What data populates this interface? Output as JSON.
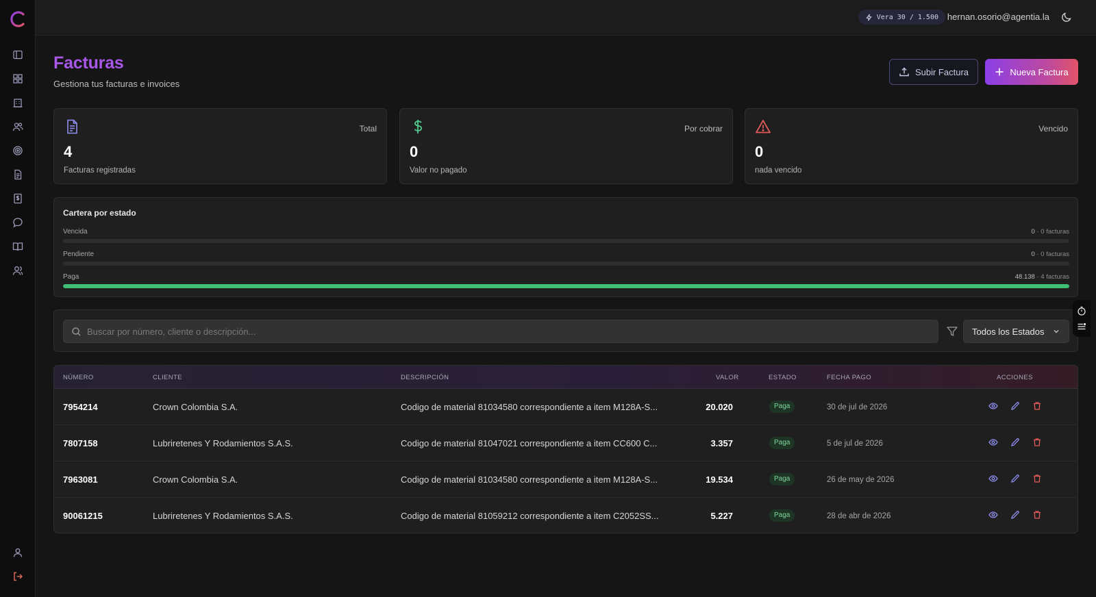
{
  "header": {
    "credits": "Vera 30 / 1.500",
    "user_email": "hernan.osorio@agentia.la"
  },
  "page": {
    "title": "Facturas",
    "subtitle": "Gestiona tus facturas e invoices",
    "upload_label": "Subir Factura",
    "new_label": "Nueva Factura"
  },
  "stats": [
    {
      "label": "Total",
      "value": "4",
      "caption": "Facturas registradas",
      "icon": "document-icon",
      "color": "#8f8ff0"
    },
    {
      "label": "Por cobrar",
      "value": "0",
      "caption": "Valor no pagado",
      "icon": "dollar-icon",
      "color": "#4fc98a"
    },
    {
      "label": "Vencido",
      "value": "0",
      "caption": "nada vencido",
      "icon": "warning-icon",
      "color": "#e25a5a"
    }
  ],
  "cartera": {
    "title": "Cartera por estado",
    "rows": [
      {
        "label": "Vencida",
        "amount": "0",
        "count": "· 0 facturas",
        "fraction": 0,
        "color": "#e25a5a"
      },
      {
        "label": "Pendiente",
        "amount": "0",
        "count": "· 0 facturas",
        "fraction": 0,
        "color": "#d6a84a"
      },
      {
        "label": "Paga",
        "amount": "48.138",
        "count": "· 4 facturas",
        "fraction": 1,
        "color": "#3fbf74"
      }
    ]
  },
  "filter": {
    "search_placeholder": "Buscar por número, cliente o descripción...",
    "status_select": "Todos los Estados"
  },
  "table": {
    "headers": {
      "numero": "NÚMERO",
      "cliente": "CLIENTE",
      "descripcion": "DESCRIPCIÓN",
      "valor": "VALOR",
      "estado": "ESTADO",
      "fecha": "FECHA PAGO",
      "acciones": "ACCIONES"
    },
    "rows": [
      {
        "numero": "7954214",
        "cliente": "Crown Colombia S.A.",
        "descripcion": "Codigo de material 81034580 correspondiente a item M128A-S...",
        "valor": "20.020",
        "estado": "Paga",
        "fecha": "30 de jul de 2026"
      },
      {
        "numero": "7807158",
        "cliente": "Lubriretenes Y Rodamientos S.A.S.",
        "descripcion": "Codigo de material 81047021 correspondiente a item CC600 C...",
        "valor": "3.357",
        "estado": "Paga",
        "fecha": "5 de jul de 2026"
      },
      {
        "numero": "7963081",
        "cliente": "Crown Colombia S.A.",
        "descripcion": "Codigo de material 81034580 correspondiente a item M128A-S...",
        "valor": "19.534",
        "estado": "Paga",
        "fecha": "26 de may de 2026"
      },
      {
        "numero": "90061215",
        "cliente": "Lubriretenes Y Rodamientos S.A.S.",
        "descripcion": "Codigo de material 81059212 correspondiente a item C2052SS...",
        "valor": "5.227",
        "estado": "Paga",
        "fecha": "28 de abr de 2026"
      }
    ]
  },
  "colors": {
    "accent": "#a857e8",
    "paid": "#7fd79c",
    "danger": "#e25a5a"
  }
}
